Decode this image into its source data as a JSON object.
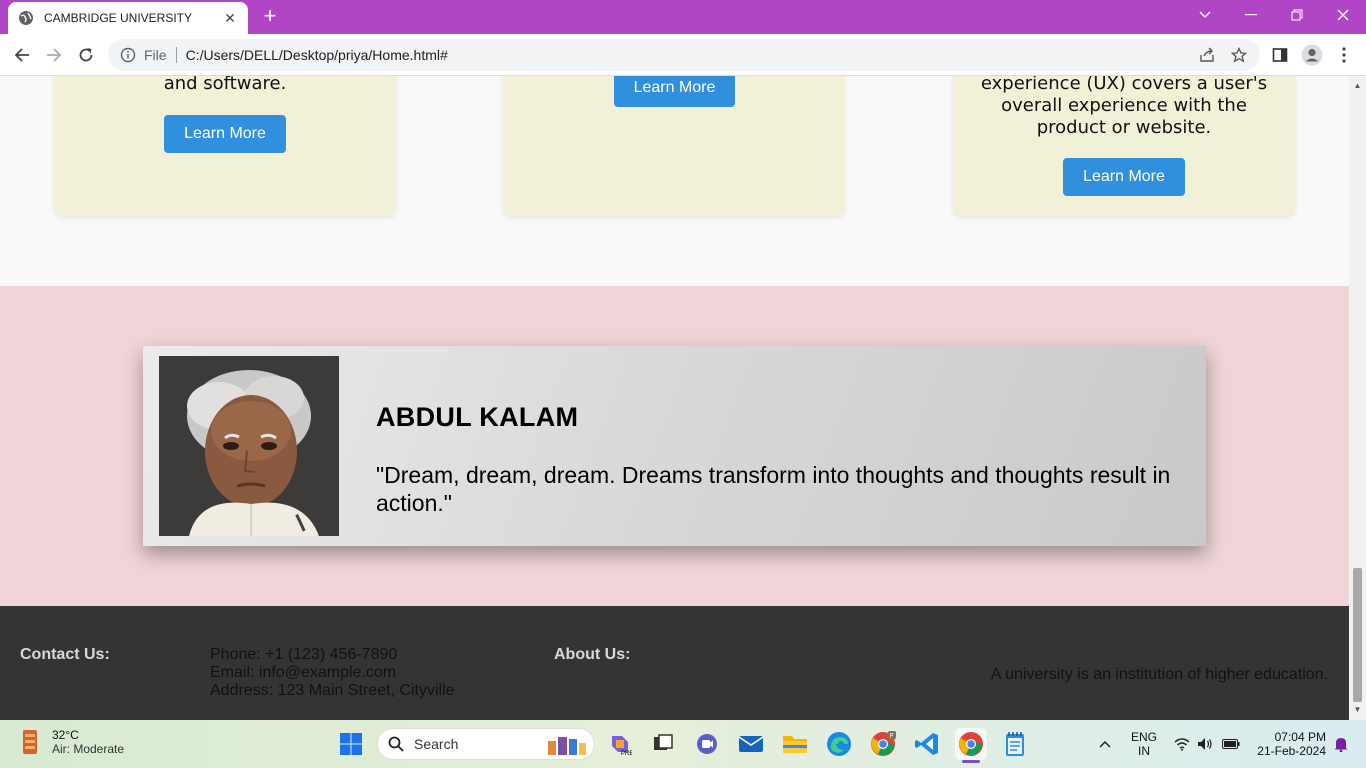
{
  "browser": {
    "tab_title": "CAMBRIDGE UNIVERSITY",
    "tab_close": "✕",
    "new_tab": "+",
    "scheme": "File",
    "url": "C:/Users/DELL/Desktop/priya/Home.html#"
  },
  "cards": [
    {
      "text": "and software.",
      "button": "Learn More"
    },
    {
      "text": "",
      "button": "Learn More"
    },
    {
      "text_lines": [
        "experience (UX) covers a user's",
        "overall experience with the",
        "product or website."
      ],
      "button": "Learn More"
    }
  ],
  "quote": {
    "name": "ABDUL KALAM",
    "text": "\"Dream, dream, dream. Dreams transform into thoughts and thoughts result in action.\""
  },
  "footer": {
    "contact_heading": "Contact Us:",
    "phone": "Phone: +1 (123) 456-7890",
    "email": "Email: info@example.com",
    "address": "Address: 123 Main Street, Cityville",
    "about_heading": "About Us:",
    "about_text": "A university is an institution of higher education."
  },
  "taskbar": {
    "temperature": "32°C",
    "air_quality": "Air: Moderate",
    "search_label": "Search",
    "language": "ENG",
    "region": "IN",
    "time": "07:04 PM",
    "date": "21-Feb-2024"
  },
  "colors": {
    "titlebar": "#b045c6",
    "button": "#3090dd",
    "card_bg": "#f3f0d8",
    "quote_section_bg": "#f0d4d7",
    "footer_bg": "#363334"
  }
}
